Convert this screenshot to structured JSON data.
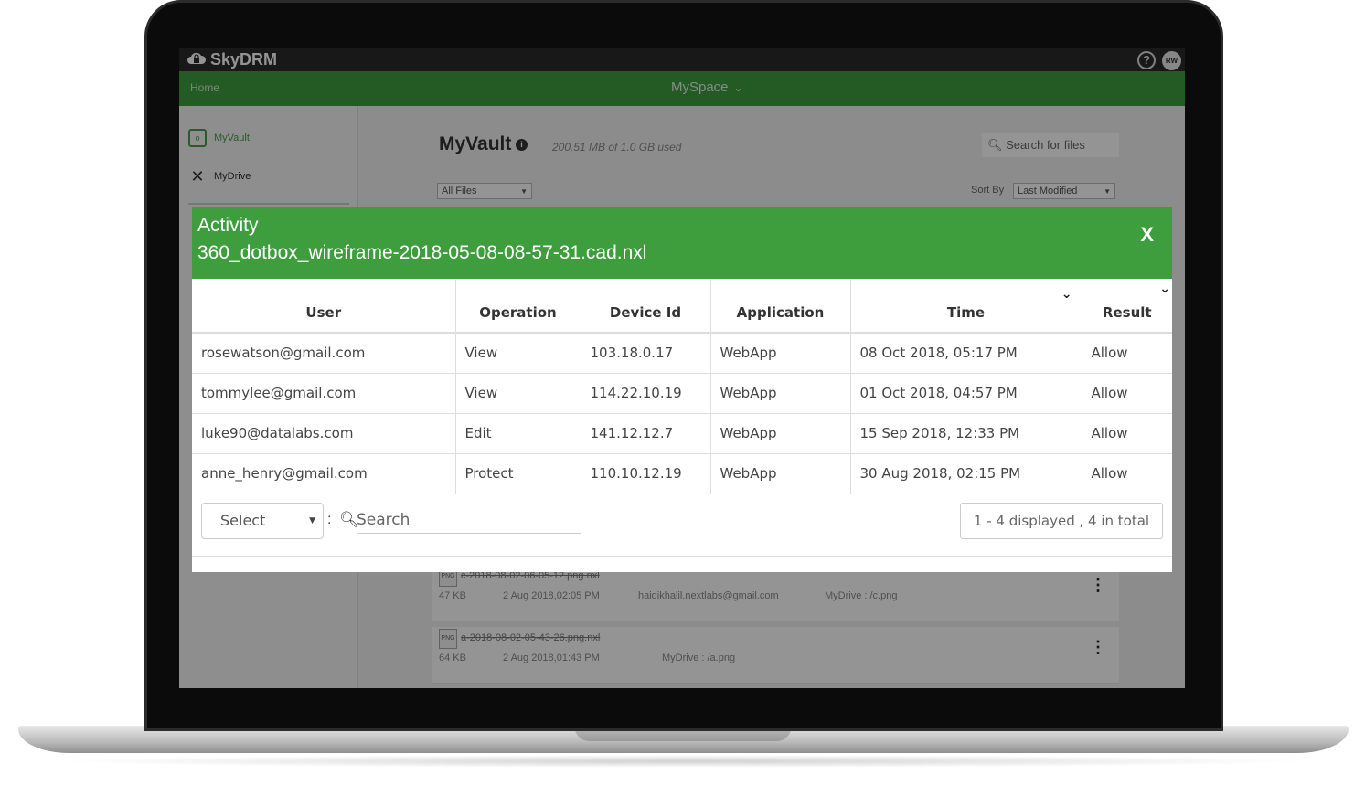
{
  "app": {
    "logo_text": "SkyDRM",
    "help_glyph": "?",
    "avatar_initials": "RW"
  },
  "navbar": {
    "home_label": "Home",
    "myspace_label": "MySpace"
  },
  "sidebar": {
    "items": [
      {
        "label": "MyVault",
        "icon": "vault-icon"
      },
      {
        "label": "MyDrive",
        "icon": "drive-icon"
      }
    ]
  },
  "main": {
    "title": "MyVault",
    "storage": "200.51 MB of 1.0 GB used",
    "search_placeholder": "Search for files",
    "filter_value": "All Files",
    "sort_label": "Sort By",
    "sort_value": "Last Modified",
    "files": [
      {
        "name": "c-2018-08-02-06-05-12.png.nxl",
        "size": "47 KB",
        "date": "2 Aug 2018,02:05 PM",
        "owner": "haidikhalil.nextlabs@gmail.com",
        "path": "MyDrive : /c.png"
      },
      {
        "name": "a-2018-08-02-05-43-26.png.nxl",
        "size": "64 KB",
        "date": "2 Aug 2018,01:43 PM",
        "owner": "",
        "path": "MyDrive : /a.png"
      }
    ]
  },
  "modal": {
    "title": "Activity",
    "filename": "360_dotbox_wireframe-2018-05-08-08-57-31.cad.nxl",
    "close_label": "X",
    "columns": [
      "User",
      "Operation",
      "Device Id",
      "Application",
      "Time",
      "Result"
    ],
    "rows": [
      {
        "user": "rosewatson@gmail.com",
        "operation": "View",
        "device_id": "103.18.0.17",
        "application": "WebApp",
        "time": "08 Oct 2018, 05:17 PM",
        "result": "Allow"
      },
      {
        "user": "tommylee@gmail.com",
        "operation": "View",
        "device_id": "114.22.10.19",
        "application": "WebApp",
        "time": "01 Oct 2018, 04:57 PM",
        "result": "Allow"
      },
      {
        "user": "luke90@datalabs.com",
        "operation": "Edit",
        "device_id": "141.12.12.7",
        "application": "WebApp",
        "time": "15 Sep 2018, 12:33 PM",
        "result": "Allow"
      },
      {
        "user": "anne_henry@gmail.com",
        "operation": "Protect",
        "device_id": "110.10.12.19",
        "application": "WebApp",
        "time": "30 Aug 2018, 02:15 PM",
        "result": "Allow"
      }
    ],
    "footer": {
      "select_value": "Select",
      "search_placeholder": "Search",
      "count_text": "1 - 4 displayed , 4 in total"
    }
  },
  "colors": {
    "brand_green": "#3e9e3e",
    "topbar": "#2a2a2a",
    "laptop_bezel": "#0b0b0b"
  }
}
